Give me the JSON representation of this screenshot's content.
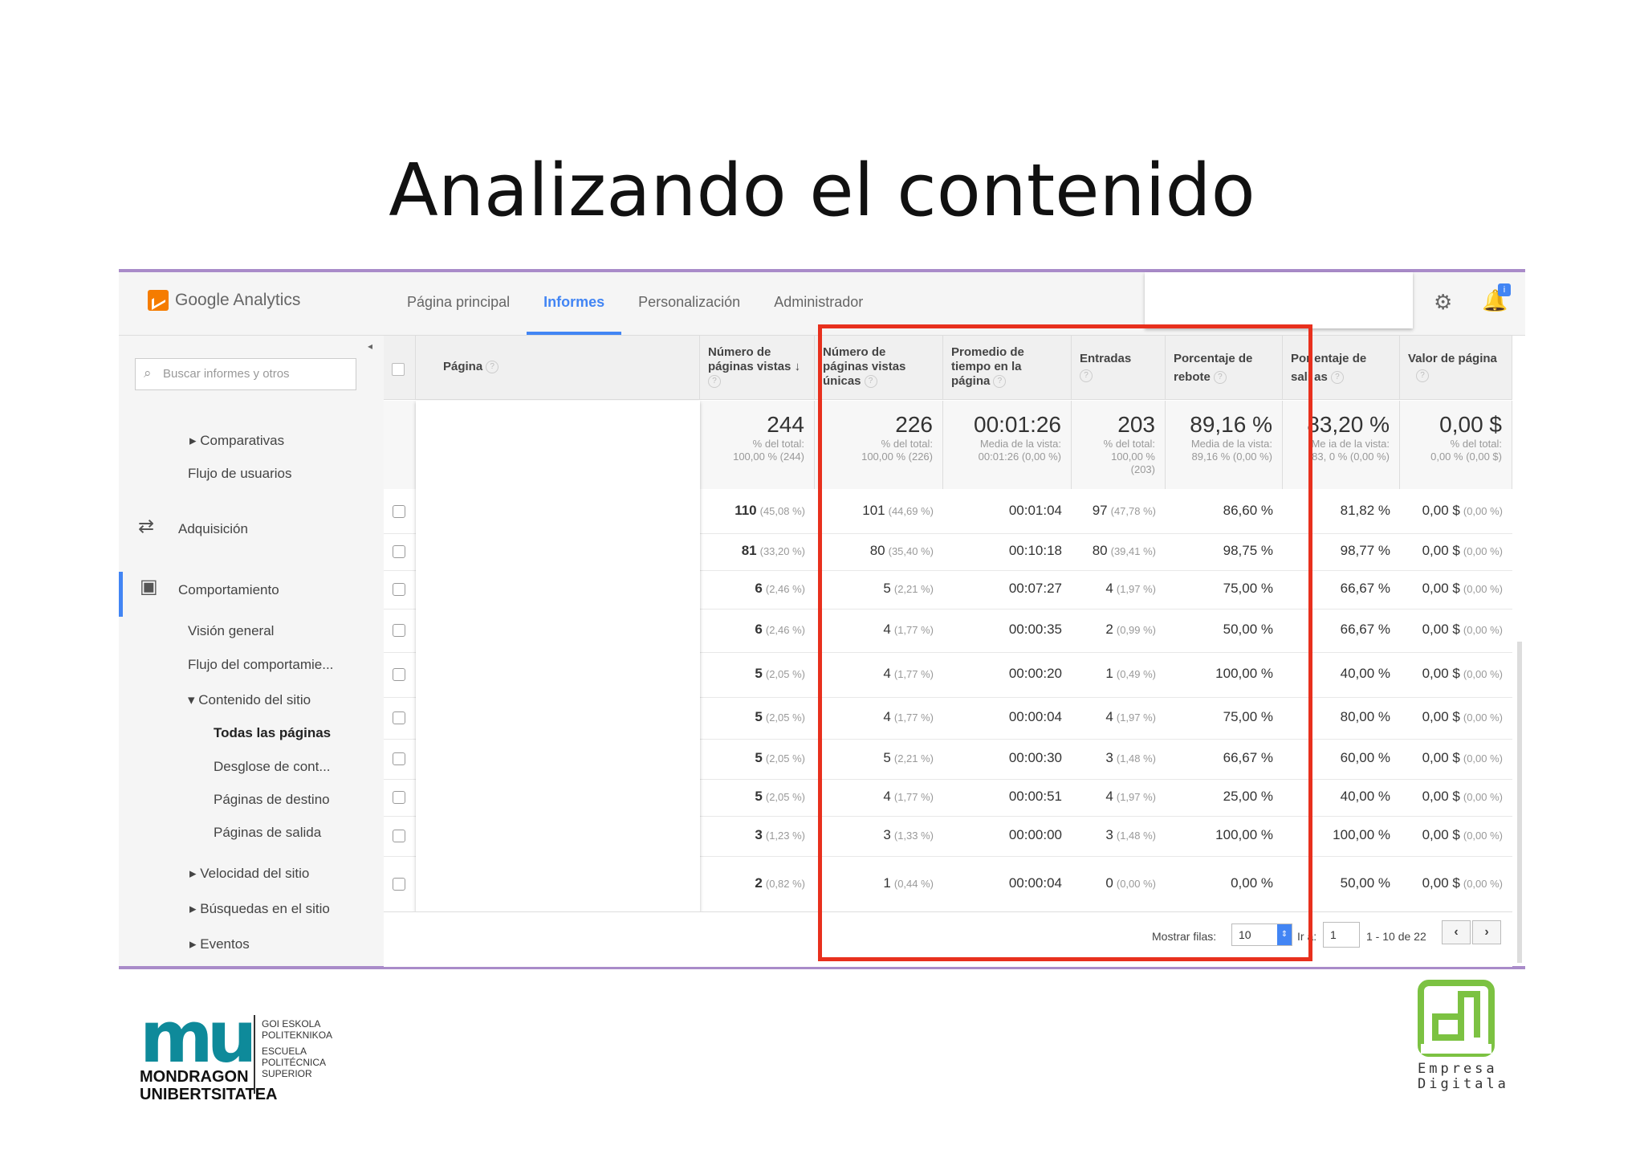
{
  "slide": {
    "title": "Analizando el contenido"
  },
  "app": {
    "logo_text": "Google Analytics",
    "notification_badge": "i"
  },
  "topnav": {
    "tabs": [
      {
        "label": "Página principal"
      },
      {
        "label": "Informes"
      },
      {
        "label": "Personalización"
      },
      {
        "label": "Administrador"
      }
    ]
  },
  "sidebar": {
    "search_placeholder": "Buscar informes y otros",
    "items": [
      "Comparativas",
      "Flujo de usuarios",
      "Adquisición",
      "Comportamiento",
      "Visión general",
      "Flujo del comportamie...",
      "Contenido del sitio",
      "Todas las páginas",
      "Desglose de cont...",
      "Páginas de destino",
      "Páginas de salida",
      "Velocidad del sitio",
      "Búsquedas en el sitio",
      "Eventos"
    ]
  },
  "table": {
    "headers": {
      "page": "Página",
      "pageviews": [
        "Número de",
        "páginas vistas"
      ],
      "unique": [
        "Número de",
        "páginas vistas",
        "únicas"
      ],
      "avg_time": [
        "Promedio de",
        "tiempo en la",
        "página"
      ],
      "entrances": [
        "Entradas"
      ],
      "bounce": [
        "Porcentaje de",
        "rebote"
      ],
      "exit": [
        "Por entaje de",
        "sali as"
      ],
      "value": [
        "Valor de página"
      ]
    },
    "totals": {
      "pageviews": {
        "value": "244",
        "l1": "% del total:",
        "l2": "100,00 % (244)"
      },
      "unique": {
        "value": "226",
        "l1": "% del total:",
        "l2": "100,00 % (226)"
      },
      "avg_time": {
        "value": "00:01:26",
        "l1": "Media de la vista:",
        "l2": "00:01:26 (0,00 %)"
      },
      "entrances": {
        "value": "203",
        "l1": "% del total:",
        "l2": "100,00 %",
        "l3": "(203)"
      },
      "bounce": {
        "value": "89,16 %",
        "l1": "Media de la vista:",
        "l2": "89,16 % (0,00 %)"
      },
      "exit": {
        "value": "83,20 %",
        "l1": "Me ia de la vista:",
        "l2": "83, 0 % (0,00 %)"
      },
      "value": {
        "value": "0,00 $",
        "l1": "% del total:",
        "l2": "0,00 % (0,00 $)"
      }
    },
    "rows": [
      {
        "pv": "110",
        "pv_pct": "(45,08 %)",
        "u": "101",
        "u_pct": "(44,69 %)",
        "t": "00:01:04",
        "e": "97",
        "e_pct": "(47,78 %)",
        "b": "86,60 %",
        "x": "81,82 %",
        "v": "0,00 $",
        "v_pct": "(0,00 %)"
      },
      {
        "pv": "81",
        "pv_pct": "(33,20 %)",
        "u": "80",
        "u_pct": "(35,40 %)",
        "t": "00:10:18",
        "e": "80",
        "e_pct": "(39,41 %)",
        "b": "98,75 %",
        "x": "98,77 %",
        "v": "0,00 $",
        "v_pct": "(0,00 %)"
      },
      {
        "pv": "6",
        "pv_pct": "(2,46 %)",
        "u": "5",
        "u_pct": "(2,21 %)",
        "t": "00:07:27",
        "e": "4",
        "e_pct": "(1,97 %)",
        "b": "75,00 %",
        "x": "66,67 %",
        "v": "0,00 $",
        "v_pct": "(0,00 %)"
      },
      {
        "pv": "6",
        "pv_pct": "(2,46 %)",
        "u": "4",
        "u_pct": "(1,77 %)",
        "t": "00:00:35",
        "e": "2",
        "e_pct": "(0,99 %)",
        "b": "50,00 %",
        "x": "66,67 %",
        "v": "0,00 $",
        "v_pct": "(0,00 %)"
      },
      {
        "pv": "5",
        "pv_pct": "(2,05 %)",
        "u": "4",
        "u_pct": "(1,77 %)",
        "t": "00:00:20",
        "e": "1",
        "e_pct": "(0,49 %)",
        "b": "100,00 %",
        "x": "40,00 %",
        "v": "0,00 $",
        "v_pct": "(0,00 %)"
      },
      {
        "pv": "5",
        "pv_pct": "(2,05 %)",
        "u": "4",
        "u_pct": "(1,77 %)",
        "t": "00:00:04",
        "e": "4",
        "e_pct": "(1,97 %)",
        "b": "75,00 %",
        "x": "80,00 %",
        "v": "0,00 $",
        "v_pct": "(0,00 %)"
      },
      {
        "pv": "5",
        "pv_pct": "(2,05 %)",
        "u": "5",
        "u_pct": "(2,21 %)",
        "t": "00:00:30",
        "e": "3",
        "e_pct": "(1,48 %)",
        "b": "66,67 %",
        "x": "60,00 %",
        "v": "0,00 $",
        "v_pct": "(0,00 %)"
      },
      {
        "pv": "5",
        "pv_pct": "(2,05 %)",
        "u": "4",
        "u_pct": "(1,77 %)",
        "t": "00:00:51",
        "e": "4",
        "e_pct": "(1,97 %)",
        "b": "25,00 %",
        "x": "40,00 %",
        "v": "0,00 $",
        "v_pct": "(0,00 %)"
      },
      {
        "pv": "3",
        "pv_pct": "(1,23 %)",
        "u": "3",
        "u_pct": "(1,33 %)",
        "t": "00:00:00",
        "e": "3",
        "e_pct": "(1,48 %)",
        "b": "100,00 %",
        "x": "100,00 %",
        "v": "0,00 $",
        "v_pct": "(0,00 %)"
      },
      {
        "pv": "2",
        "pv_pct": "(0,82 %)",
        "u": "1",
        "u_pct": "(0,44 %)",
        "t": "00:00:04",
        "e": "0",
        "e_pct": "(0,00 %)",
        "b": "0,00 %",
        "x": "50,00 %",
        "v": "0,00 $",
        "v_pct": "(0,00 %)"
      }
    ],
    "footer": {
      "rows_label": "Mostrar filas:",
      "rows_value": "10",
      "goto_label": "Ir a:",
      "goto_value": "1",
      "range": "1 - 10 de 22"
    }
  },
  "logos": {
    "mondragon": {
      "name1": "MONDRAGON",
      "name2": "UNIBERTSITATEA",
      "side": [
        "GOI ESKOLA",
        "POLITEKNIKOA",
        "ESCUELA",
        "POLITÉCNICA",
        "SUPERIOR"
      ]
    },
    "empresa": {
      "line1": "Empresa",
      "line2": "Digitala"
    }
  },
  "colors": {
    "accent_blue": "#4285f4",
    "highlight_red": "#e8301d",
    "frame_purple": "#a98bc9",
    "brand_teal": "#0e8a9a",
    "brand_green": "#7cc242"
  }
}
